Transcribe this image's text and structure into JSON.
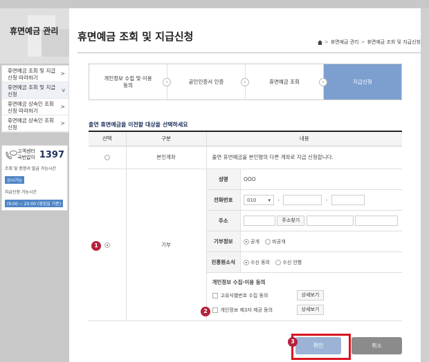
{
  "sidebar": {
    "title": "휴면예금 관리",
    "items": [
      {
        "label": "휴면예금 조회 및 지급신청 따라하기",
        "arrow": ">",
        "active": false
      },
      {
        "label": "휴면예금 조회 및 지급신청",
        "arrow": "v",
        "active": true
      },
      {
        "label": "휴면예금 상속인 조회신청 따라하기",
        "arrow": ">",
        "active": false
      },
      {
        "label": "휴면예금 상속인 조회신청",
        "arrow": ">",
        "active": false
      }
    ],
    "cs": {
      "label": "고객센터 국번없이",
      "number": "1397",
      "line1": "조회 및 증명서 발급 가능시간",
      "badge1": "상시가능",
      "line2": "지급신청 가능시간",
      "badge2": "(9:00 ~ 20:00 (영업일 기준)"
    }
  },
  "header": {
    "title": "휴면예금 조회 및 지급신청",
    "breadcrumb": [
      "휴면예금 관리",
      "휴면예금 조회 및 지급신청"
    ],
    "sep": ">"
  },
  "steps": [
    {
      "label": "개인정보 수집 및 이용동의",
      "active": false
    },
    {
      "label": "공인인증서 인증",
      "active": false
    },
    {
      "label": "휴면예금 조회",
      "active": false
    },
    {
      "label": "지급신청",
      "active": true
    }
  ],
  "section_label": "출연 휴면예금을 이전할 대상을 선택하세요",
  "table": {
    "headers": [
      "선택",
      "구분",
      "내용"
    ],
    "row1": {
      "kind": "본인계좌",
      "content": "출연 휴면예금을 본인명의 다른 계좌로 지급 신청합니다."
    },
    "row2": {
      "kind": "기부",
      "name_label": "성명",
      "name_value": "OOO",
      "phone_label": "전화번호",
      "phone_prefix": "010",
      "dash": "-",
      "addr_label": "주소",
      "addr_button": "주소찾기",
      "receipt_label": "기부정보",
      "receipt_options": [
        "공개",
        "비공개"
      ],
      "promo_label": "진흥원소식",
      "promo_options": [
        "수신 동의",
        "수신 안함"
      ],
      "consent_head": "개인정보 수집·이용 동의",
      "consents": [
        {
          "label": "고유식별번호 수집 동의",
          "button": "상세보기"
        },
        {
          "label": "개인정보 제3자 제공 동의",
          "button": "상세보기"
        }
      ]
    }
  },
  "markers": [
    "1",
    "2",
    "3"
  ],
  "buttons": {
    "confirm": "확인",
    "cancel": "취소"
  },
  "colors": {
    "accent": "#7c9fcf",
    "marker": "#b5213b",
    "highlight": "#d8141f",
    "confirm": "#9cb3d6",
    "cancel": "#8b8b8b"
  }
}
